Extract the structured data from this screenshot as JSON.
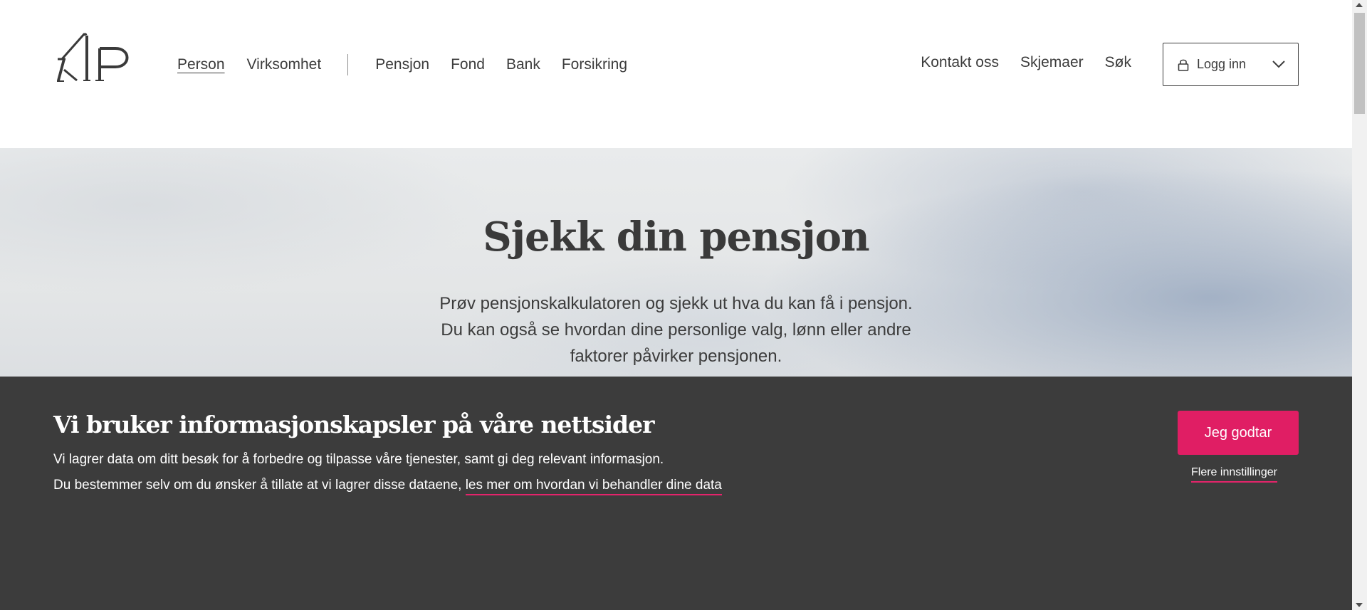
{
  "header": {
    "logo_text": "KLP",
    "nav_left": [
      {
        "label": "Person",
        "active": true
      },
      {
        "label": "Virksomhet",
        "active": false
      }
    ],
    "nav_products": [
      {
        "label": "Pensjon"
      },
      {
        "label": "Fond"
      },
      {
        "label": "Bank"
      },
      {
        "label": "Forsikring"
      }
    ],
    "nav_right": [
      {
        "label": "Kontakt oss"
      },
      {
        "label": "Skjemaer"
      },
      {
        "label": "Søk"
      }
    ],
    "login": {
      "label": "Logg inn",
      "icon": "lock-icon",
      "dropdown_icon": "chevron-down-icon"
    }
  },
  "hero": {
    "title": "Sjekk din pensjon",
    "text_lines": [
      "Prøv pensjonskalkulatoren og sjekk ut hva du kan få i pensjon.",
      "Du kan også se hvordan dine personlige valg, lønn eller andre",
      "faktorer påvirker pensjonen."
    ]
  },
  "cookie_banner": {
    "title": "Vi bruker informasjonskapsler på våre nettsider",
    "line1": "Vi lagrer data om ditt besøk for å forbedre og tilpasse våre tjenester, samt gi deg relevant informasjon.",
    "line2_prefix": "Du bestemmer selv om du ønsker å tillate at vi lagrer disse dataene, ",
    "line2_link": "les mer om hvordan vi behandler dine data",
    "accept_label": "Jeg godtar",
    "settings_label": "Flere innstillinger"
  },
  "colors": {
    "accent": "#e01e64",
    "banner_bg": "#3c3c3c",
    "text": "#3c3c3c"
  }
}
